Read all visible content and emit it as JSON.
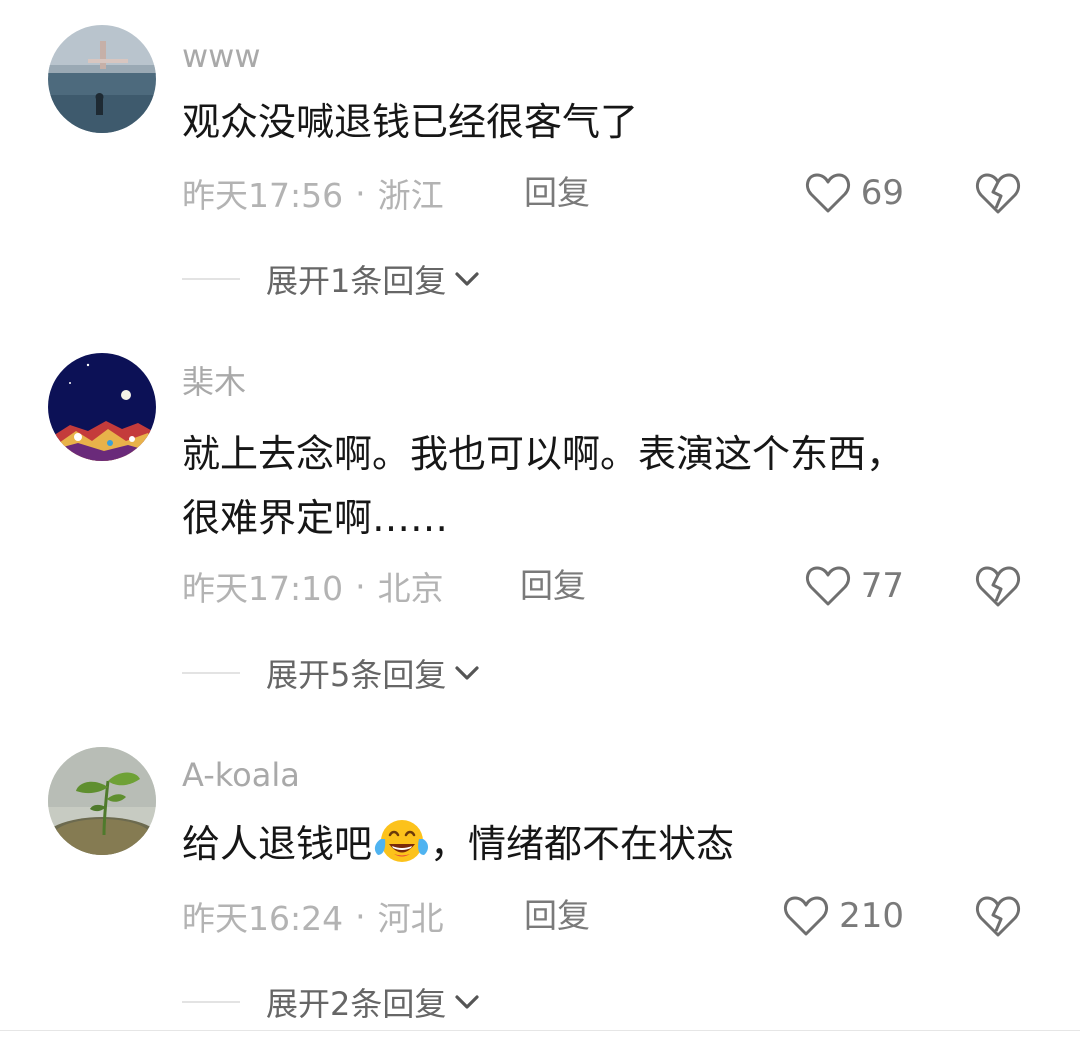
{
  "comments": [
    {
      "username": "www",
      "lines": [
        "观众没喊退钱已经很客气了"
      ],
      "time": "昨天17:56",
      "separator": "·",
      "location": "浙江",
      "reply_label": "回复",
      "likes": "69",
      "expand_label": "展开1条回复",
      "avatar_icon": "avatar-seascape",
      "like_icon": "heart-outline-icon",
      "dislike_icon": "broken-heart-icon",
      "expand_icon": "chevron-down-icon"
    },
    {
      "username": "棐木",
      "lines": [
        "就上去念啊。我也可以啊。表演这个东西，",
        "很难界定啊……"
      ],
      "time": "昨天17:10",
      "separator": "·",
      "location": "北京",
      "reply_label": "回复",
      "likes": "77",
      "expand_label": "展开5条回复",
      "avatar_icon": "avatar-night-sky",
      "like_icon": "heart-outline-icon",
      "dislike_icon": "broken-heart-icon",
      "expand_icon": "chevron-down-icon"
    },
    {
      "username": "A-koala",
      "line_before_emoji": "给人退钱吧",
      "emoji_icon": "face-with-tears-of-joy-emoji",
      "line_after_emoji": "，情绪都不在状态",
      "time": "昨天16:24",
      "separator": "·",
      "location": "河北",
      "reply_label": "回复",
      "likes": "210",
      "expand_label": "展开2条回复",
      "avatar_icon": "avatar-seedling",
      "like_icon": "heart-outline-icon",
      "dislike_icon": "broken-heart-icon",
      "expand_icon": "chevron-down-icon"
    }
  ],
  "colors": {
    "username": "#a9a9a9",
    "content": "#161616",
    "meta": "#b3b3b3",
    "action": "#7a7a7a",
    "expand": "#666666",
    "divider": "#e3e3e3"
  }
}
